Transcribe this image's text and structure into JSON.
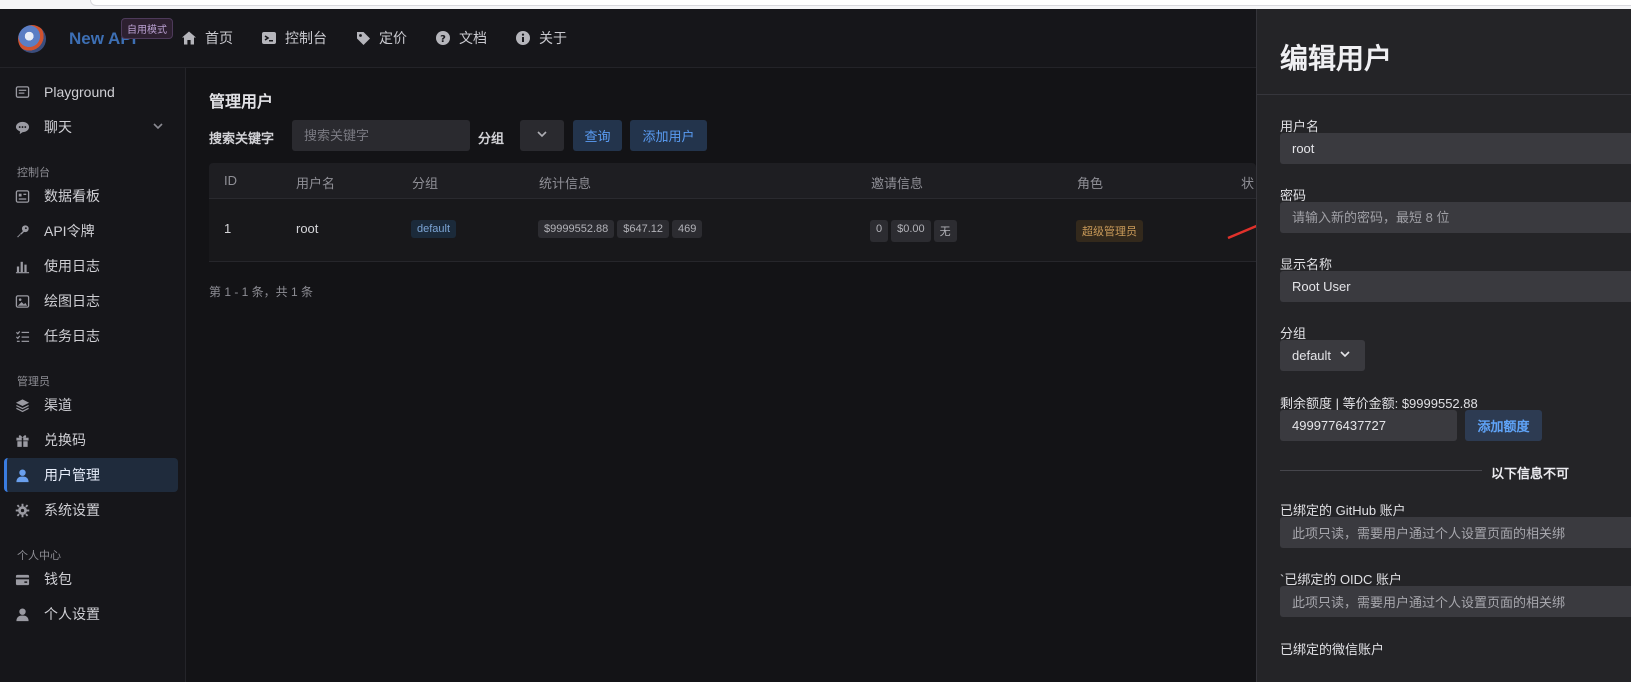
{
  "header": {
    "brand": "New API",
    "mode_badge": "自用模式",
    "nav": [
      {
        "label": "首页",
        "icon": "home-icon"
      },
      {
        "label": "控制台",
        "icon": "terminal-icon"
      },
      {
        "label": "定价",
        "icon": "tag-icon"
      },
      {
        "label": "文档",
        "icon": "help-circle-icon"
      },
      {
        "label": "关于",
        "icon": "info-circle-icon"
      }
    ]
  },
  "sidebar": {
    "items": [
      {
        "label": "Playground",
        "icon": "chat-window-icon"
      },
      {
        "label": "聊天",
        "icon": "chat-bubble-icon"
      },
      {
        "label": "数据看板",
        "icon": "dashboard-icon"
      },
      {
        "label": "API令牌",
        "icon": "key-icon"
      },
      {
        "label": "使用日志",
        "icon": "bar-chart-icon"
      },
      {
        "label": "绘图日志",
        "icon": "image-icon"
      },
      {
        "label": "任务日志",
        "icon": "checklist-icon"
      },
      {
        "label": "渠道",
        "icon": "layers-icon"
      },
      {
        "label": "兑换码",
        "icon": "gift-icon"
      },
      {
        "label": "用户管理",
        "icon": "user-icon"
      },
      {
        "label": "系统设置",
        "icon": "gear-icon"
      },
      {
        "label": "钱包",
        "icon": "wallet-icon"
      },
      {
        "label": "个人设置",
        "icon": "user-icon"
      }
    ],
    "sections": [
      "控制台",
      "管理员",
      "个人中心"
    ]
  },
  "main": {
    "title": "管理用户",
    "search_label": "搜索关键字",
    "search_placeholder": "搜索关键字",
    "group_label": "分组",
    "query_button": "查询",
    "add_button": "添加用户",
    "columns": [
      "ID",
      "用户名",
      "分组",
      "统计信息",
      "邀请信息",
      "角色",
      "状"
    ],
    "rows": [
      {
        "id": "1",
        "username": "root",
        "group": "default",
        "stats": [
          "$9999552.88",
          "$647.12",
          "469"
        ],
        "invite": [
          "0",
          "$0.00",
          "无"
        ],
        "role": "超级管理员"
      }
    ],
    "pagination": "第 1 - 1 条，共 1 条"
  },
  "sheet": {
    "title": "编辑用户",
    "username_label": "用户名",
    "username_value": "root",
    "password_label": "密码",
    "password_placeholder": "请输入新的密码，最短 8 位",
    "display_name_label": "显示名称",
    "display_name_value": "Root User",
    "group_label": "分组",
    "group_value": "default",
    "quota_label": "剩余额度 | 等价金额: $9999552.88",
    "quota_value": "4999776437727",
    "add_quota_button": "添加额度",
    "separator_text": "以下信息不可",
    "github_label": "已绑定的 GitHub 账户",
    "github_value": "此项只读，需要用户通过个人设置页面的相关绑",
    "oidc_label": "`已绑定的 OIDC 账户",
    "oidc_value": "此项只读，需要用户通过个人设置页面的相关绑",
    "wechat_label": "已绑定的微信账户"
  },
  "colors": {
    "accent": "#3a7ce0",
    "link": "#5a9cf3",
    "annotation_arrow": "#e0312b"
  }
}
